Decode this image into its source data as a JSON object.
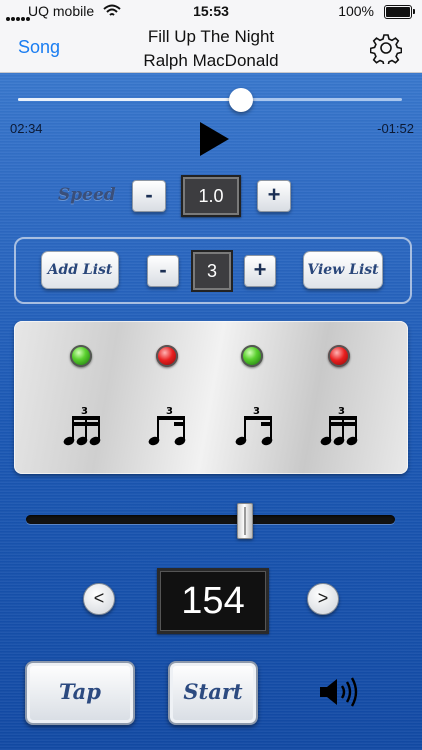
{
  "status_bar": {
    "carrier": "UQ mobile",
    "time": "15:53",
    "battery_percent": "100%"
  },
  "nav": {
    "back_label": "Song",
    "title_line1": "Fill Up The Night",
    "title_line2": "Ralph MacDonald",
    "settings_icon": "gear-icon"
  },
  "player": {
    "elapsed": "02:34",
    "remaining": "-01:52",
    "progress_fraction": 0.58,
    "play_icon": "play-icon"
  },
  "speed": {
    "label": "Speed",
    "minus": "-",
    "value": "1.0",
    "plus": "+"
  },
  "list": {
    "add_label": "Add List",
    "minus": "-",
    "value": "3",
    "plus": "+",
    "view_label": "View List"
  },
  "beats": [
    {
      "led": "green",
      "note": "triplet-sixteenth-icon",
      "triplet": "3"
    },
    {
      "led": "red",
      "note": "triplet-eighth-sixteenth-icon",
      "triplet": "3"
    },
    {
      "led": "green",
      "note": "triplet-eighth-sixteenth-icon",
      "triplet": "3"
    },
    {
      "led": "red",
      "note": "triplet-sixteenth-icon",
      "triplet": "3"
    }
  ],
  "tempo": {
    "slider_fraction": 0.59,
    "down": "<",
    "value": "154",
    "up": ">"
  },
  "controls": {
    "tap_label": "Tap",
    "start_label": "Start",
    "speaker_icon": "speaker-icon"
  },
  "colors": {
    "accent": "#1a7df1",
    "led_green": "#5bd12f",
    "led_red": "#e81f1f",
    "button_text": "#2c4a80"
  }
}
